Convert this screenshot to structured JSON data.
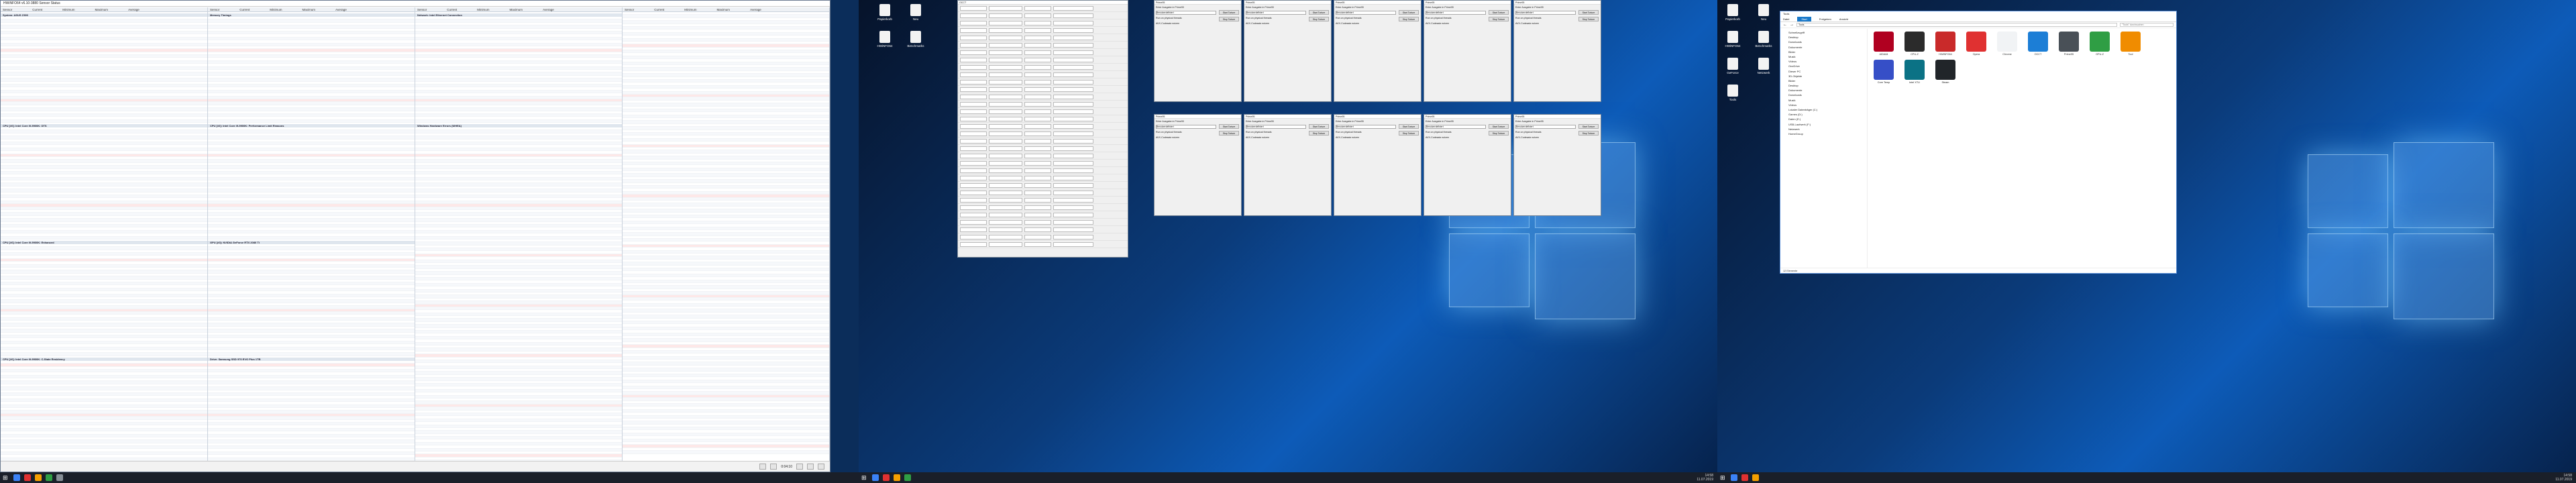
{
  "monitor1": {
    "window_title": "HWiNFO64 v6.10-3880 Sensor Status",
    "columns": [
      "Sensor",
      "Current",
      "Minimum",
      "Maximum",
      "Average"
    ],
    "status_time": "0:04:10",
    "groups": [
      "System: ASUS Z390",
      "CPU [#0]: Intel Core i9-9900K: DTS",
      "CPU [#0]: Intel Core i9-9900K: Enhanced",
      "CPU [#0]: Intel Core i9-9900K: C-State Residency",
      "Memory Timings",
      "CPU [#0]: Intel Core i9-9900K: Performance Limit Reasons",
      "GPU [#0]: NVIDIA GeForce RTX 2080 Ti",
      "Drive: Samsung SSD 970 EVO Plus 1TB",
      "Network: Intel Ethernet Connection",
      "Windows Hardware Errors (WHEA)"
    ],
    "desktop_icons": [
      "Papierkorb",
      "Neu",
      "HWiNFO64",
      "3DMark",
      "Unigine"
    ]
  },
  "monitor2": {
    "form_title": "OCCT",
    "tool_window_title": "Prime95",
    "tool_label": "Enter Ausgabe in Prime95",
    "tool_field": "Benutzerdefiniert",
    "tool_checkbox_1": "Run on physical threads",
    "tool_checkbox_2": "AVX-Codesatz nutzen",
    "tool_buttons": [
      "Start Torture",
      "Stop Torture"
    ],
    "desktop_icons": [
      "Papierkorb",
      "Neu",
      "HWiNFO64",
      "Benchmarks"
    ],
    "time": "14:58",
    "date": "11.07.2019"
  },
  "monitor3": {
    "explorer": {
      "title": "Tools",
      "tabs": [
        "Datei",
        "Start",
        "Freigeben",
        "Ansicht"
      ],
      "active_tab": "Start",
      "address": "Tools",
      "search_placeholder": "\"Tools\" durchsuchen",
      "nav_items": [
        "Schnellzugriff",
        "Desktop",
        "Downloads",
        "Dokumente",
        "Bilder",
        "Musik",
        "Videos",
        "OneDrive",
        "Dieser PC",
        "3D-Objekte",
        "Bilder",
        "Desktop",
        "Dokumente",
        "Downloads",
        "Musik",
        "Videos",
        "Lokaler Datenträger (C:)",
        "Games (D:)",
        "Daten (E:)",
        "USB-Laufwerk (F:)",
        "Netzwerk",
        "HomeGroup"
      ],
      "files": [
        "AIDA64",
        "CPU-Z",
        "HWiNFO64",
        "Opera",
        "Chrome",
        "OCCT",
        "Prime95",
        "GPU-Z",
        "Tool",
        "Core Temp",
        "Intel XTU",
        "Steam"
      ],
      "status": "12 Elemente"
    },
    "desktop_icons": [
      "Papierkorb",
      "Neu",
      "HWiNFO64",
      "Benchmarks",
      "GeForce",
      "Netzwerk",
      "Tools"
    ],
    "time": "14:58",
    "date": "11.07.2019"
  },
  "colors": {
    "wallpaper": "#0b3b7a",
    "taskbar": "#1a1f29",
    "accent": "#1979ca"
  }
}
